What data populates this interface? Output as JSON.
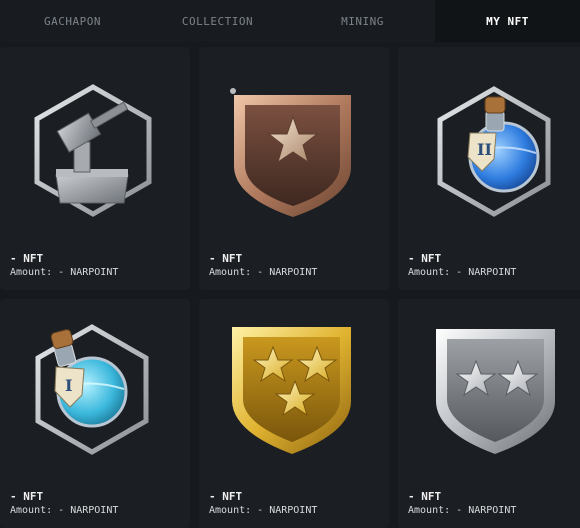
{
  "tabs": [
    {
      "label": "GACHAPON",
      "active": false
    },
    {
      "label": "COLLECTION",
      "active": false
    },
    {
      "label": "MINING",
      "active": false
    },
    {
      "label": "MY NFT",
      "active": true
    }
  ],
  "cards": [
    {
      "name": "- NFT",
      "amount": "Amount: - NARPOINT",
      "icon": "hammer-icon"
    },
    {
      "name": "- NFT",
      "amount": "Amount: - NARPOINT",
      "icon": "bronze-shield-icon"
    },
    {
      "name": "- NFT",
      "amount": "Amount: - NARPOINT",
      "icon": "blue-potion-ii-icon"
    },
    {
      "name": "- NFT",
      "amount": "Amount: - NARPOINT",
      "icon": "cyan-potion-i-icon"
    },
    {
      "name": "- NFT",
      "amount": "Amount: - NARPOINT",
      "icon": "gold-shield-icon"
    },
    {
      "name": "- NFT",
      "amount": "Amount: - NARPOINT",
      "icon": "silver-shield-icon"
    }
  ],
  "colors": {
    "background": "#161a1e",
    "card": "#1b1f23",
    "tab_active_text": "#ffffff",
    "tab_text": "#7d838a"
  }
}
